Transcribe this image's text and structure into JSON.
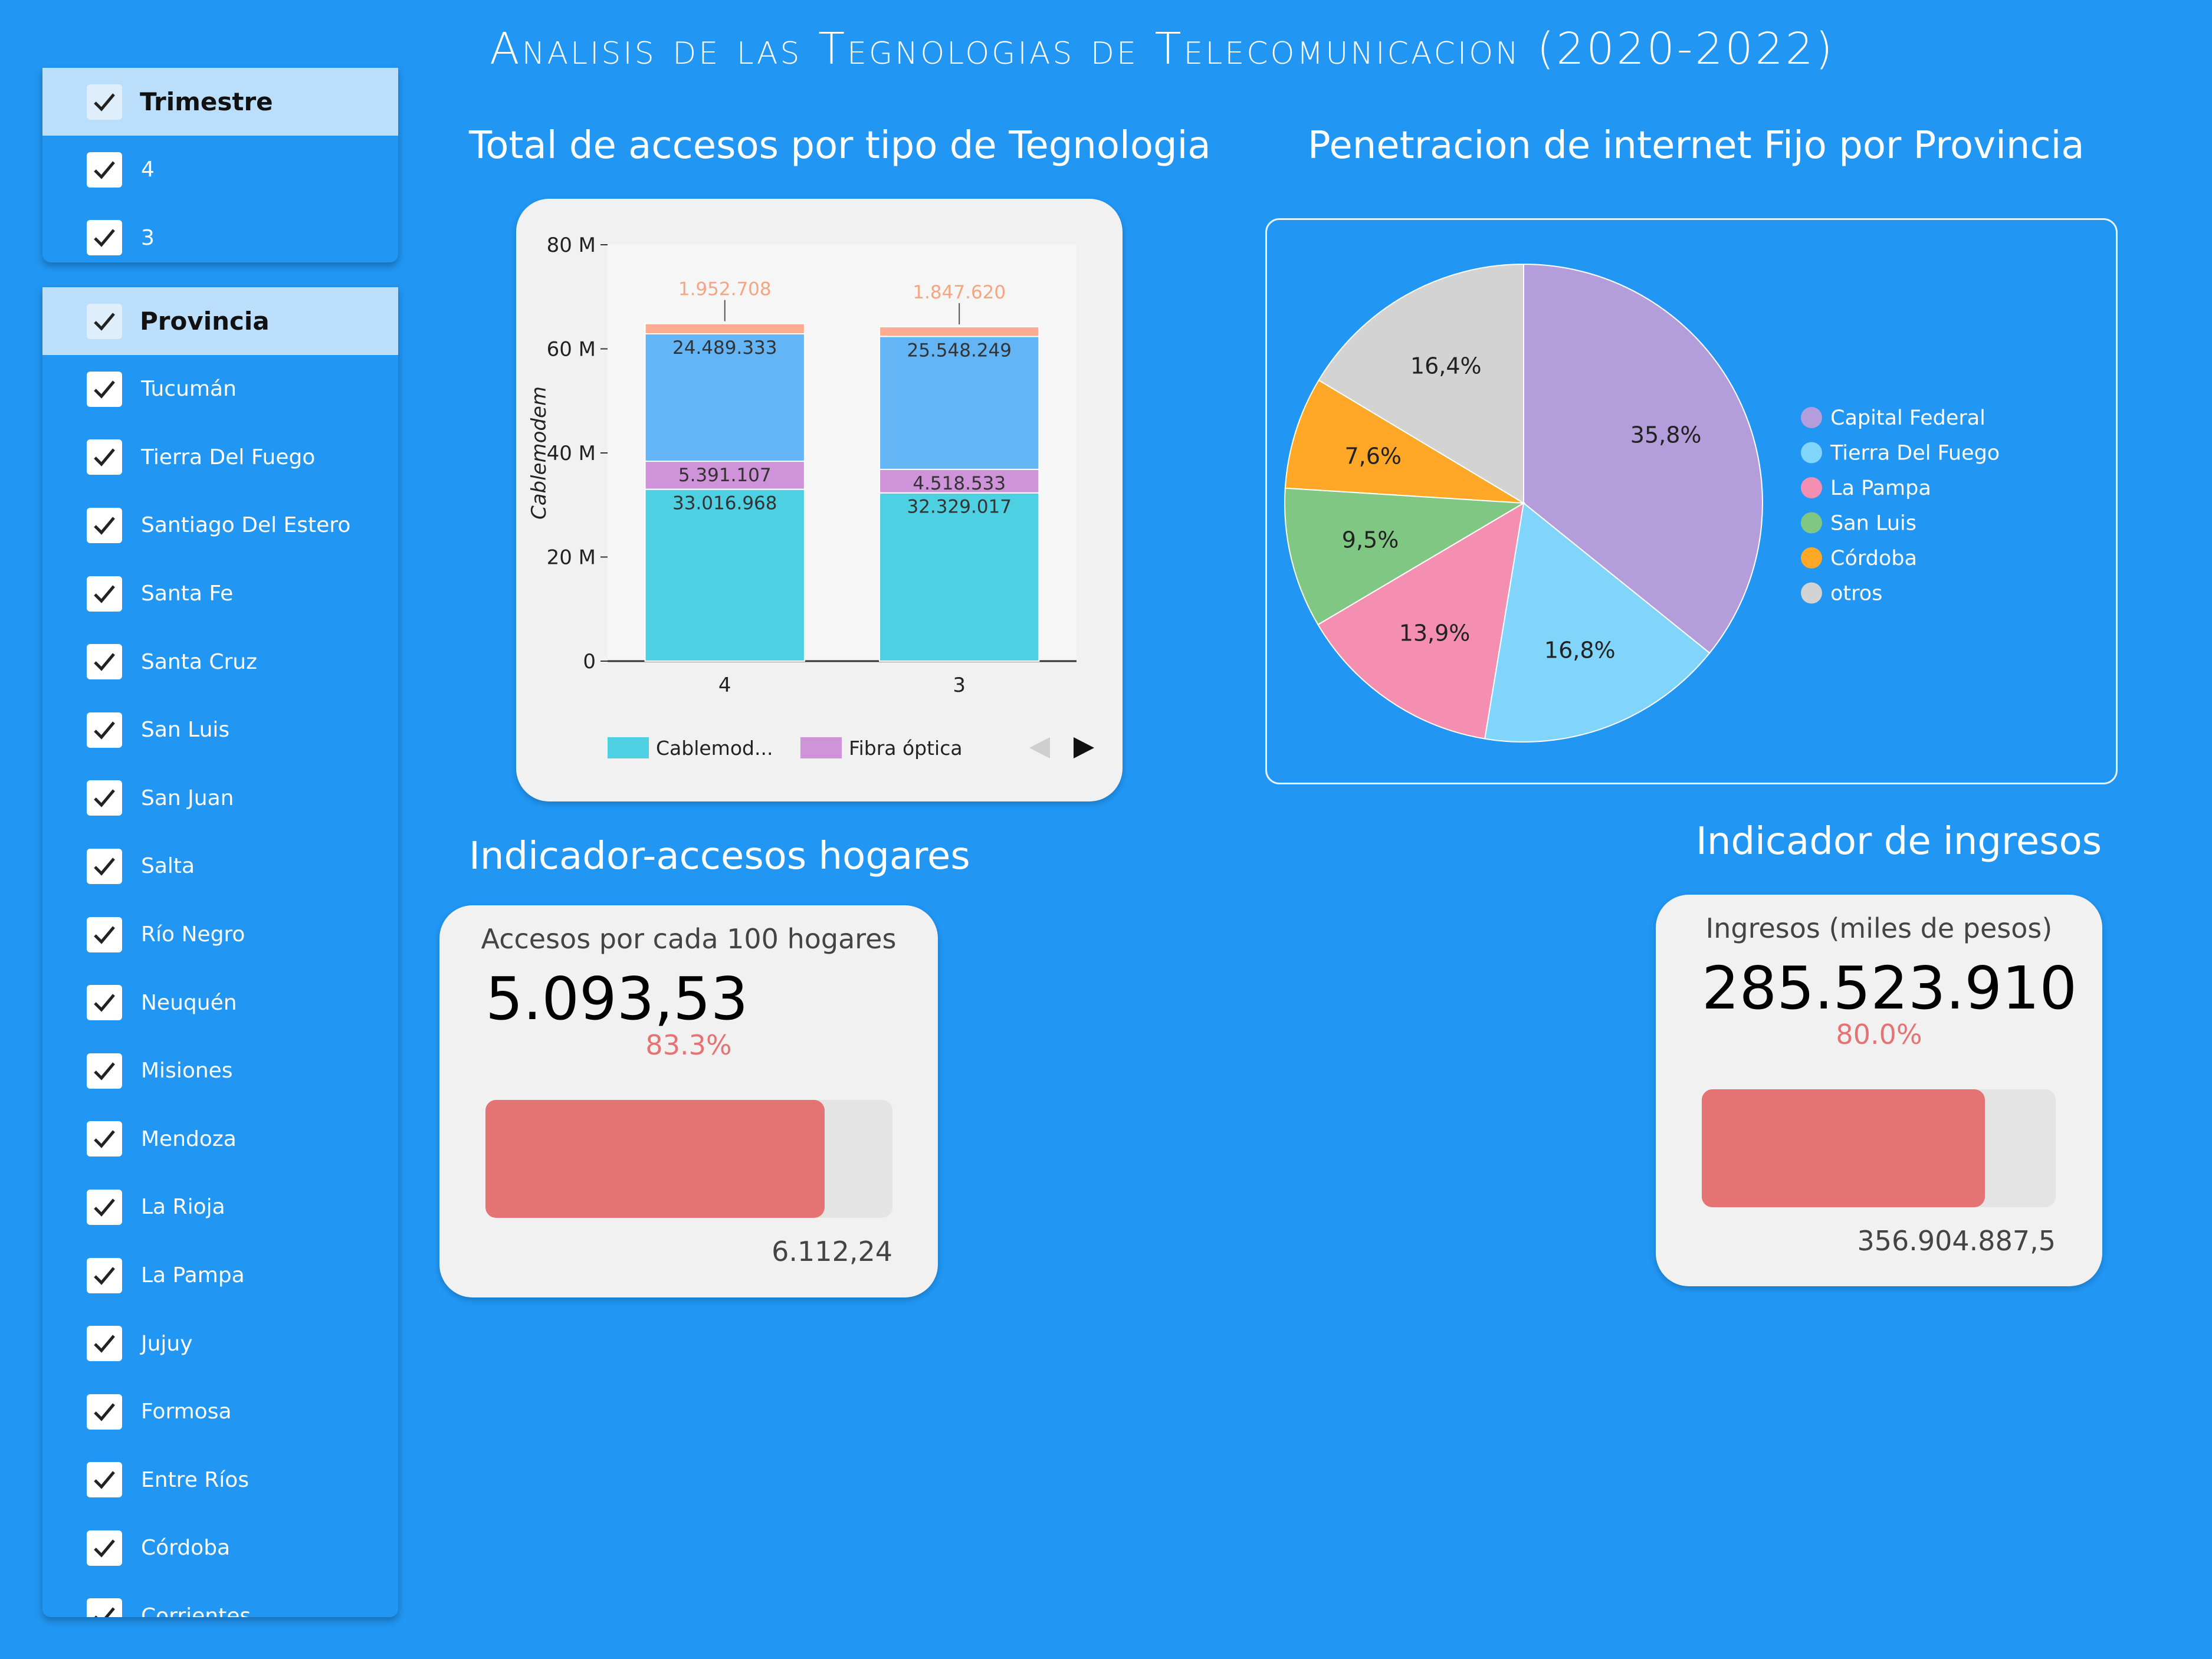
{
  "title": "Analisis de las Tegnologias de Telecomunicacion (2020-2022)",
  "slicers": {
    "trimestre": {
      "header": "Trimestre",
      "items": [
        "4",
        "3"
      ]
    },
    "provincia": {
      "header": "Provincia",
      "items": [
        "Tucumán",
        "Tierra Del Fuego",
        "Santiago Del Estero",
        "Santa Fe",
        "Santa Cruz",
        "San Luis",
        "San Juan",
        "Salta",
        "Río Negro",
        "Neuquén",
        "Misiones",
        "Mendoza",
        "La Rioja",
        "La Pampa",
        "Jujuy",
        "Formosa",
        "Entre Ríos",
        "Córdoba",
        "Corrientes"
      ]
    }
  },
  "bar_section_title": "Total de accesos por tipo de Tegnologia",
  "pie_section_title": "Penetracion de internet Fijo por Provincia",
  "kpi_hogares": {
    "section_title": "Indicador-accesos hogares",
    "label": "Accesos por cada 100 hogares",
    "value": "5.093,53",
    "percent": "83.3%",
    "progress": 0.833,
    "target": "6.112,24"
  },
  "kpi_ingresos": {
    "section_title": "Indicador de ingresos",
    "label": "Ingresos (miles de pesos)",
    "value": "285.523.910",
    "percent": "80.0%",
    "progress": 0.8,
    "target": "356.904.887,5"
  },
  "icons": {
    "checkbox": "check-icon",
    "legend_prev": "triangle-left-icon",
    "legend_next": "triangle-right-icon"
  },
  "chart_data": [
    {
      "type": "bar",
      "stacked": true,
      "categories": [
        "4",
        "3"
      ],
      "ylabel": "Cablemodem",
      "ylim": [
        0,
        80000000
      ],
      "yticks": [
        "0",
        "20 M",
        "40 M",
        "60 M",
        "80 M"
      ],
      "ytick_values": [
        0,
        20000000,
        40000000,
        60000000,
        80000000
      ],
      "series": [
        {
          "name": "Cablemod...",
          "color": "#4DD0E1",
          "values": [
            33016968,
            32329017
          ],
          "labels": [
            "33.016.968",
            "32.329.017"
          ]
        },
        {
          "name": "Fibra óptica",
          "color": "#CE93D8",
          "values": [
            5391107,
            4518533
          ],
          "labels": [
            "5.391.107",
            "4.518.533"
          ]
        },
        {
          "color": "#64B5F6",
          "values": [
            24489333,
            25548249
          ],
          "labels": [
            "24.489.333",
            "25.548.249"
          ]
        },
        {
          "color": "#FFAB91",
          "values": [
            1952708,
            1847620
          ],
          "labels": [
            "1.952.708",
            "1.847.620"
          ]
        }
      ],
      "legend_position": "bottom"
    },
    {
      "type": "pie",
      "slices": [
        {
          "name": "Capital Federal",
          "value": 35.8,
          "label": "35,8%",
          "color": "#B39DDB"
        },
        {
          "name": "Tierra Del Fuego",
          "value": 16.8,
          "label": "16,8%",
          "color": "#81D4FA"
        },
        {
          "name": "La Pampa",
          "value": 13.9,
          "label": "13,9%",
          "color": "#F48FB1"
        },
        {
          "name": "San Luis",
          "value": 9.5,
          "label": "9,5%",
          "color": "#81C784"
        },
        {
          "name": "Córdoba",
          "value": 7.6,
          "label": "7,6%",
          "color": "#FFA726"
        },
        {
          "name": "otros",
          "value": 16.4,
          "label": "16,4%",
          "color": "#D3D3D3"
        }
      ],
      "legend_position": "right"
    }
  ]
}
